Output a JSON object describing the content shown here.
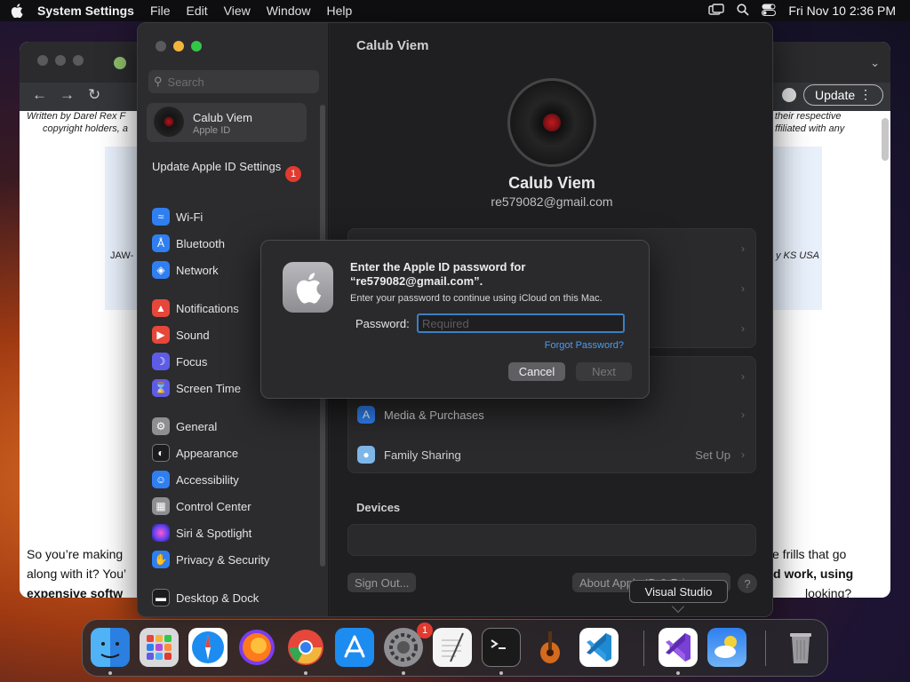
{
  "menubar": {
    "app_name": "System Settings",
    "menus": [
      "File",
      "Edit",
      "View",
      "Window",
      "Help"
    ],
    "clock": "Fri Nov 10  2:36 PM"
  },
  "browser": {
    "update_label": "Update",
    "doc_line1_left": "Written by Darel Rex F",
    "doc_line1_right": "d by their respective",
    "doc_line2_left": "copyright holders, a",
    "doc_line2_right": "ffiliated with any",
    "banner_left": "JAW-",
    "banner_right": "y KS USA",
    "body_line1_left": "So you’re making",
    "body_line1_right": "e frills that go",
    "body_line2_left": "along with it? You’",
    "body_line2_right": "d work, using",
    "body_line3_left": "expensive softw",
    "body_line3_right": "looking?"
  },
  "settings": {
    "search_placeholder": "Search",
    "account": {
      "name": "Calub Viem",
      "subtitle": "Apple ID"
    },
    "update_appleid": "Update Apple ID Settings",
    "update_badge": "1",
    "sidebar_items": [
      {
        "label": "Wi-Fi",
        "icon": "wifi-icon",
        "color": "#2f7ff0"
      },
      {
        "label": "Bluetooth",
        "icon": "bluetooth-icon",
        "color": "#2f7ff0"
      },
      {
        "label": "Network",
        "icon": "globe-icon",
        "color": "#2f7ff0"
      },
      {
        "label": "Notifications",
        "icon": "bell-icon",
        "color": "#e5473a"
      },
      {
        "label": "Sound",
        "icon": "speaker-icon",
        "color": "#e5473a"
      },
      {
        "label": "Focus",
        "icon": "moon-icon",
        "color": "#5e5ce6"
      },
      {
        "label": "Screen Time",
        "icon": "hourglass-icon",
        "color": "#5e5ce6"
      },
      {
        "label": "General",
        "icon": "gear-icon",
        "color": "#8e8e93"
      },
      {
        "label": "Appearance",
        "icon": "appearance-icon",
        "color": "#1c1c1e"
      },
      {
        "label": "Accessibility",
        "icon": "accessibility-icon",
        "color": "#2f7ff0"
      },
      {
        "label": "Control Center",
        "icon": "control-center-icon",
        "color": "#8e8e93"
      },
      {
        "label": "Siri & Spotlight",
        "icon": "siri-icon",
        "color": "#b04fd6"
      },
      {
        "label": "Privacy & Security",
        "icon": "hand-icon",
        "color": "#2f7ff0"
      },
      {
        "label": "Desktop & Dock",
        "icon": "dock-icon",
        "color": "#1c1c1e"
      }
    ],
    "title": "Calub Viem",
    "profile_name": "Calub Viem",
    "profile_email": "re579082@gmail.com",
    "rows": [
      {
        "label": "Media & Purchases",
        "icon": "app-store-icon",
        "value": ""
      },
      {
        "label": "Family Sharing",
        "icon": "family-icon",
        "value": "Set Up"
      }
    ],
    "devices_heading": "Devices",
    "sign_out": "Sign Out...",
    "about": "About Apple ID & Privacy...",
    "help": "?"
  },
  "dialog": {
    "title_line1": "Enter the Apple ID password for",
    "title_line2": "“re579082@gmail.com”.",
    "subtitle": "Enter your password to continue using iCloud on this Mac.",
    "password_label": "Password:",
    "password_placeholder": "Required",
    "password_value": "",
    "forgot": "Forgot Password?",
    "cancel": "Cancel",
    "next": "Next"
  },
  "tooltip": "Visual Studio",
  "dock": {
    "badge": "1",
    "apps": [
      "Finder",
      "Launchpad",
      "Safari",
      "Firefox",
      "Chrome",
      "App Store",
      "System Settings",
      "TextEdit",
      "Terminal",
      "GarageBand",
      "Visual Studio Code",
      "Visual Studio",
      "Weather",
      "Trash"
    ]
  }
}
